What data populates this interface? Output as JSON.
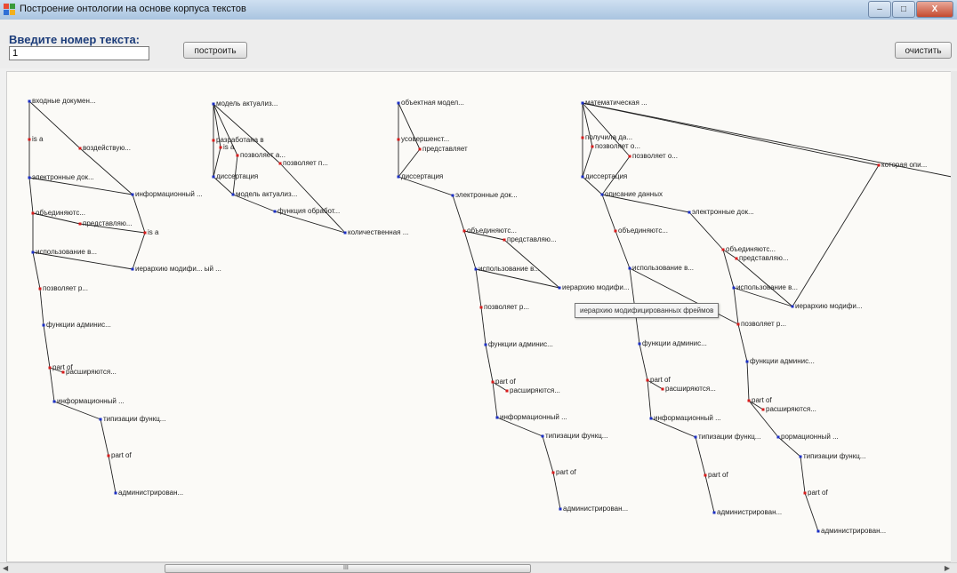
{
  "window": {
    "title": "Построение онтологии на основе корпуса текстов",
    "close_label": "X"
  },
  "form": {
    "prompt_label": "Введите номер текста:",
    "text_number_value": "1",
    "build_button": "построить",
    "clear_button": "очистить"
  },
  "tooltip_text": "иерархию модифицированных фреймов",
  "hscroll_grip": "III",
  "colors": {
    "marker_red": "#d81b1b",
    "marker_blue": "#1b2fc4",
    "edge": "#222222"
  },
  "trees": [
    {
      "nodes": [
        {
          "id": "a1",
          "label": "входные докумен...",
          "marker": "blue"
        },
        {
          "id": "a2",
          "label": "is a",
          "marker": "red"
        },
        {
          "id": "a3",
          "label": "воздействую...",
          "marker": "red"
        },
        {
          "id": "a4",
          "label": "электронные док...",
          "marker": "blue"
        },
        {
          "id": "a5",
          "label": "информационный ...",
          "marker": "blue"
        },
        {
          "id": "a6",
          "label": "объединяютс...",
          "marker": "red"
        },
        {
          "id": "a7",
          "label": "представляю...",
          "marker": "red"
        },
        {
          "id": "a8",
          "label": "is a",
          "marker": "red"
        },
        {
          "id": "a9",
          "label": "использование в...",
          "marker": "blue"
        },
        {
          "id": "a10",
          "label": "иерархию модифи... ый ...",
          "marker": "blue"
        },
        {
          "id": "a11",
          "label": "позволяет р...",
          "marker": "red"
        },
        {
          "id": "a12",
          "label": "функции админис...",
          "marker": "blue"
        },
        {
          "id": "a13",
          "label": "part of",
          "marker": "red"
        },
        {
          "id": "a14",
          "label": "расширяются...",
          "marker": "red"
        },
        {
          "id": "a15",
          "label": "информационный ...",
          "marker": "blue"
        },
        {
          "id": "a16",
          "label": "типизации функц...",
          "marker": "blue"
        },
        {
          "id": "a17",
          "label": "part of",
          "marker": "red"
        },
        {
          "id": "a18",
          "label": "администрирован...",
          "marker": "blue"
        }
      ]
    },
    {
      "nodes": [
        {
          "id": "b1",
          "label": "модель актуализ...",
          "marker": "blue"
        },
        {
          "id": "b2",
          "label": "разработана в",
          "marker": "red"
        },
        {
          "id": "b3",
          "label": "is a",
          "marker": "red"
        },
        {
          "id": "b4",
          "label": "позволяет а...",
          "marker": "red"
        },
        {
          "id": "b5",
          "label": "позволяет п...",
          "marker": "red"
        },
        {
          "id": "b6",
          "label": "диссертация",
          "marker": "blue"
        },
        {
          "id": "b7",
          "label": "модель актуализ...",
          "marker": "blue"
        },
        {
          "id": "b8",
          "label": "функция обработ...",
          "marker": "blue"
        },
        {
          "id": "b9",
          "label": "количественная ...",
          "marker": "blue"
        }
      ]
    },
    {
      "nodes": [
        {
          "id": "c1",
          "label": "объектная модел...",
          "marker": "blue"
        },
        {
          "id": "c2",
          "label": "усовершенст...",
          "marker": "red"
        },
        {
          "id": "c3",
          "label": "представляет",
          "marker": "red"
        },
        {
          "id": "c4",
          "label": "диссертация",
          "marker": "blue"
        },
        {
          "id": "c5",
          "label": "электронные док...",
          "marker": "blue"
        },
        {
          "id": "c6",
          "label": "объединяютс...",
          "marker": "red"
        },
        {
          "id": "c7",
          "label": "представляю...",
          "marker": "red"
        },
        {
          "id": "c8",
          "label": "использование в...",
          "marker": "blue"
        },
        {
          "id": "c9",
          "label": "иерархию модифи...",
          "marker": "blue"
        },
        {
          "id": "c10",
          "label": "позволяет р...",
          "marker": "red"
        },
        {
          "id": "c11",
          "label": "функции админис...",
          "marker": "blue"
        },
        {
          "id": "c12",
          "label": "part of",
          "marker": "red"
        },
        {
          "id": "c13",
          "label": "расширяются...",
          "marker": "red"
        },
        {
          "id": "c14",
          "label": "информационный ...",
          "marker": "blue"
        },
        {
          "id": "c15",
          "label": "типизации функц...",
          "marker": "blue"
        },
        {
          "id": "c16",
          "label": "part of",
          "marker": "red"
        },
        {
          "id": "c17",
          "label": "администрирован...",
          "marker": "blue"
        }
      ]
    },
    {
      "nodes": [
        {
          "id": "d1",
          "label": "математическая ...",
          "marker": "blue"
        },
        {
          "id": "d2",
          "label": "получила да...",
          "marker": "red"
        },
        {
          "id": "d3",
          "label": "позволяет о...",
          "marker": "red"
        },
        {
          "id": "d4",
          "label": "позволяет о...",
          "marker": "red"
        },
        {
          "id": "d5",
          "label": "которая опи...",
          "marker": "red"
        },
        {
          "id": "d6",
          "label": "диссертация",
          "marker": "blue"
        },
        {
          "id": "d7",
          "label": "описание данных",
          "marker": "blue"
        },
        {
          "id": "d8",
          "label": "электронные док...",
          "marker": "blue"
        },
        {
          "id": "d9",
          "label": "объединяютс...",
          "marker": "red"
        },
        {
          "id": "d10",
          "label": "объединяютс...",
          "marker": "red"
        },
        {
          "id": "d11",
          "label": "представляю...",
          "marker": "red"
        },
        {
          "id": "d12",
          "label": "использование в...",
          "marker": "blue"
        },
        {
          "id": "d13",
          "label": "использование в...",
          "marker": "blue"
        },
        {
          "id": "d14",
          "label": "иерархию модифи...",
          "marker": "blue"
        },
        {
          "id": "d15",
          "label": "позволяет р...",
          "marker": "red"
        },
        {
          "id": "d16",
          "label": "функции админис...",
          "marker": "blue"
        },
        {
          "id": "d17",
          "label": "функции админис...",
          "marker": "blue"
        },
        {
          "id": "d18",
          "label": "part of",
          "marker": "red"
        },
        {
          "id": "d19",
          "label": "расширяются...",
          "marker": "red"
        },
        {
          "id": "d20",
          "label": "part of",
          "marker": "red"
        },
        {
          "id": "d21",
          "label": "расширяются...",
          "marker": "red"
        },
        {
          "id": "d22",
          "label": "информационный ...",
          "marker": "blue"
        },
        {
          "id": "d23",
          "label": "типизации функц...",
          "marker": "blue"
        },
        {
          "id": "d24",
          "label": "рормационный ...",
          "marker": "blue"
        },
        {
          "id": "d25",
          "label": "типизации функц...",
          "marker": "blue"
        },
        {
          "id": "d26",
          "label": "part of",
          "marker": "red"
        },
        {
          "id": "d27",
          "label": "part of",
          "marker": "red"
        },
        {
          "id": "d28",
          "label": "администрирован...",
          "marker": "blue"
        },
        {
          "id": "d29",
          "label": "администрирован...",
          "marker": "blue"
        }
      ]
    }
  ]
}
